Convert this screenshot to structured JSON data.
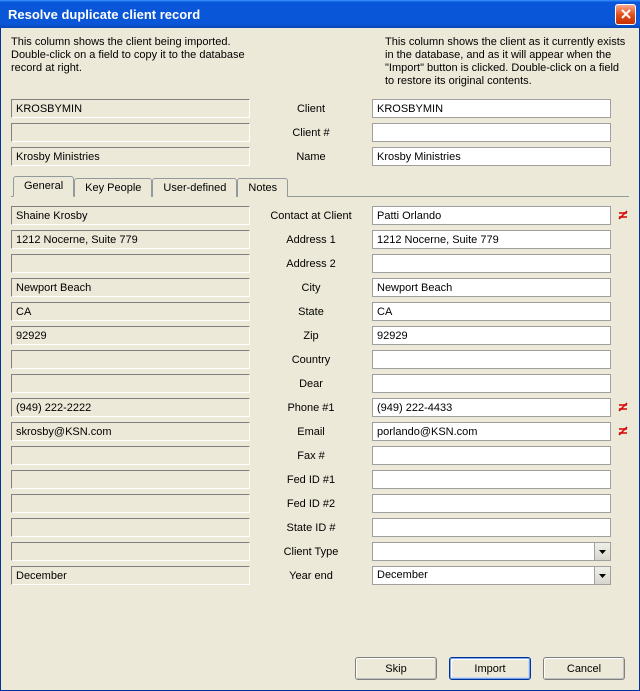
{
  "title": "Resolve duplicate client record",
  "desc": {
    "left": "This column shows the client being imported. Double-click on a field to copy it to the database record at right.",
    "right": "This column shows the client as it currently exists in the database, and as it will appear when the \"Import\" button is clicked. Double-click on a field to restore its original contents."
  },
  "header": {
    "client_label": "Client",
    "clientnum_label": "Client #",
    "name_label": "Name",
    "left": {
      "client": "KROSBYMIN",
      "clientnum": "",
      "name": "Krosby Ministries"
    },
    "right": {
      "client": "KROSBYMIN",
      "clientnum": "",
      "name": "Krosby Ministries"
    }
  },
  "tabs": [
    "General",
    "Key People",
    "User-defined",
    "Notes"
  ],
  "fields": [
    {
      "label": "Contact at Client",
      "left": "Shaine Krosby",
      "right": "Patti Orlando",
      "diff": true
    },
    {
      "label": "Address 1",
      "left": "1212 Nocerne, Suite 779",
      "right": "1212 Nocerne, Suite 779"
    },
    {
      "label": "Address 2",
      "left": "",
      "right": ""
    },
    {
      "label": "City",
      "left": "Newport Beach",
      "right": "Newport Beach"
    },
    {
      "label": "State",
      "left": "CA",
      "right": "CA"
    },
    {
      "label": "Zip",
      "left": "92929",
      "right": "92929"
    },
    {
      "label": "Country",
      "left": "",
      "right": ""
    },
    {
      "label": "Dear",
      "left": "",
      "right": ""
    },
    {
      "label": "Phone #1",
      "left": "(949) 222-2222",
      "right": "(949) 222-4433",
      "diff": true
    },
    {
      "label": "Email",
      "left": "skrosby@KSN.com",
      "right": "porlando@KSN.com",
      "diff": true
    },
    {
      "label": "Fax #",
      "left": "",
      "right": ""
    },
    {
      "label": "Fed ID #1",
      "left": "",
      "right": ""
    },
    {
      "label": "Fed ID #2",
      "left": "",
      "right": ""
    },
    {
      "label": "State ID #",
      "left": "",
      "right": ""
    },
    {
      "label": "Client Type",
      "left": "",
      "right": "",
      "combo": true
    },
    {
      "label": "Year end",
      "left": "December",
      "right": "December",
      "combo": true
    }
  ],
  "buttons": {
    "skip": "Skip",
    "import": "Import",
    "cancel": "Cancel"
  }
}
